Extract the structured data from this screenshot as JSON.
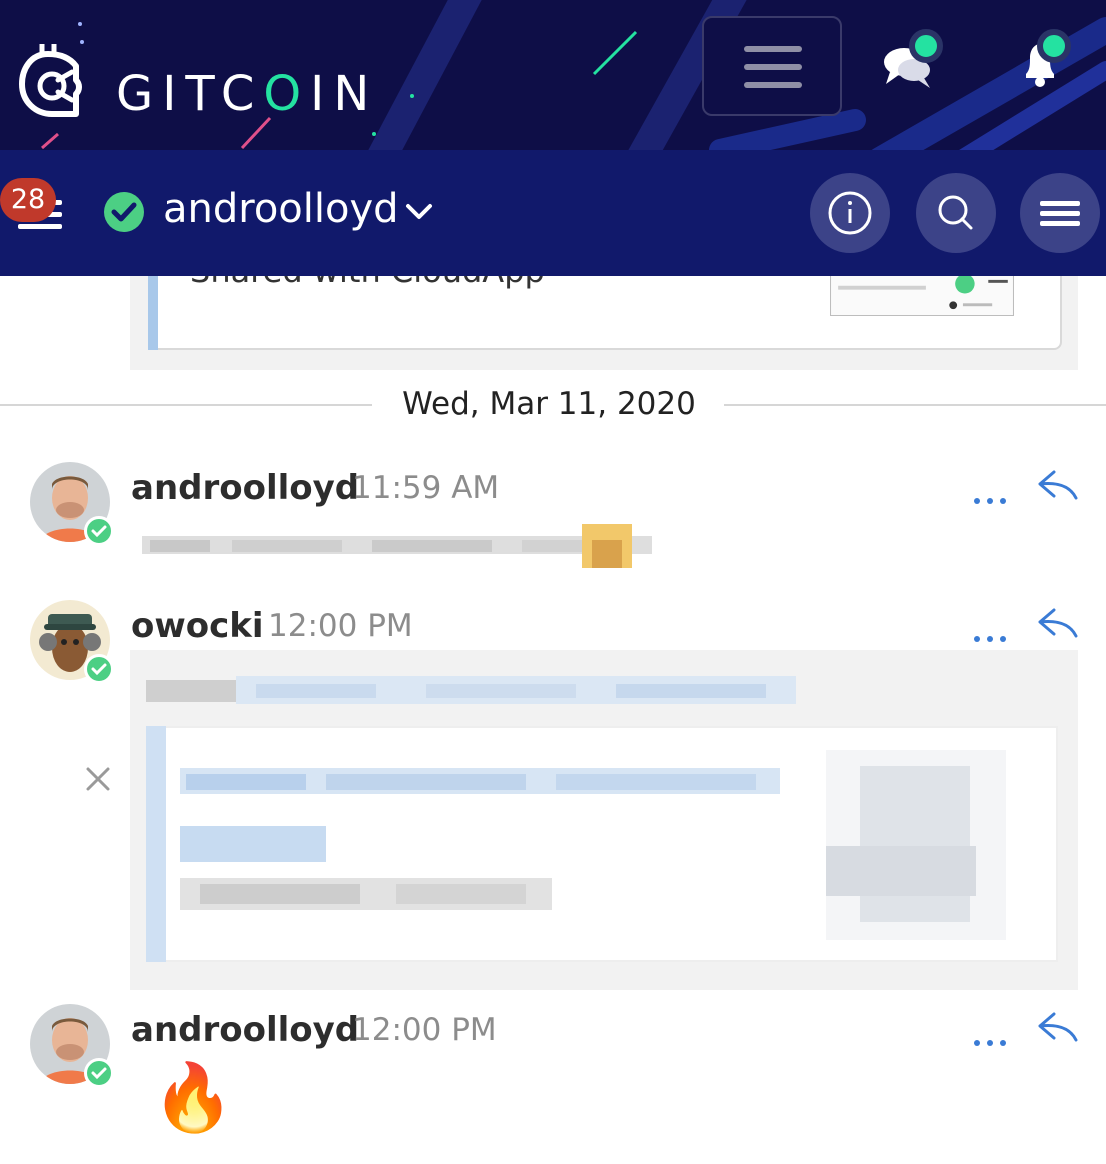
{
  "header": {
    "brand": {
      "prefix": "GITC",
      "o": "O",
      "suffix": "IN"
    },
    "icons": {
      "logo": "gitcoin-robot-icon",
      "menu": "hamburger-menu-icon",
      "chat": "chat-bubbles-icon",
      "notifications": "bell-icon"
    },
    "accent": "#24e2a1",
    "bg": "#0e0e47"
  },
  "nav": {
    "unread_badge": "28",
    "room_name": "androolloyd",
    "status_icon": "check-circle-icon",
    "icons": {
      "info": "info-icon",
      "search": "search-icon",
      "menu": "menu-icon",
      "dropdown": "chevron-down-icon"
    },
    "bg": "#11196b"
  },
  "previous_attachment": {
    "text": "Shared with CloudApp"
  },
  "date_divider": "Wed, Mar 11, 2020",
  "messages": [
    {
      "author": "androolloyd",
      "time": "11:59 AM",
      "avatar": "avatar-androolloyd",
      "body_blurred": true
    },
    {
      "author": "owocki",
      "time": "12:00 PM",
      "avatar": "avatar-owocki",
      "body_blurred": true,
      "has_link_preview": true
    },
    {
      "author": "androolloyd",
      "time": "12:00 PM",
      "avatar": "avatar-androolloyd",
      "emoji": "🔥"
    }
  ],
  "message_actions": {
    "more": "more-dots-icon",
    "reply": "reply-arrow-icon",
    "dismiss_preview": "close-x-icon"
  },
  "colors": {
    "online": "#4ccf84",
    "link": "#3a7bd5",
    "badge": "#c0392b"
  }
}
